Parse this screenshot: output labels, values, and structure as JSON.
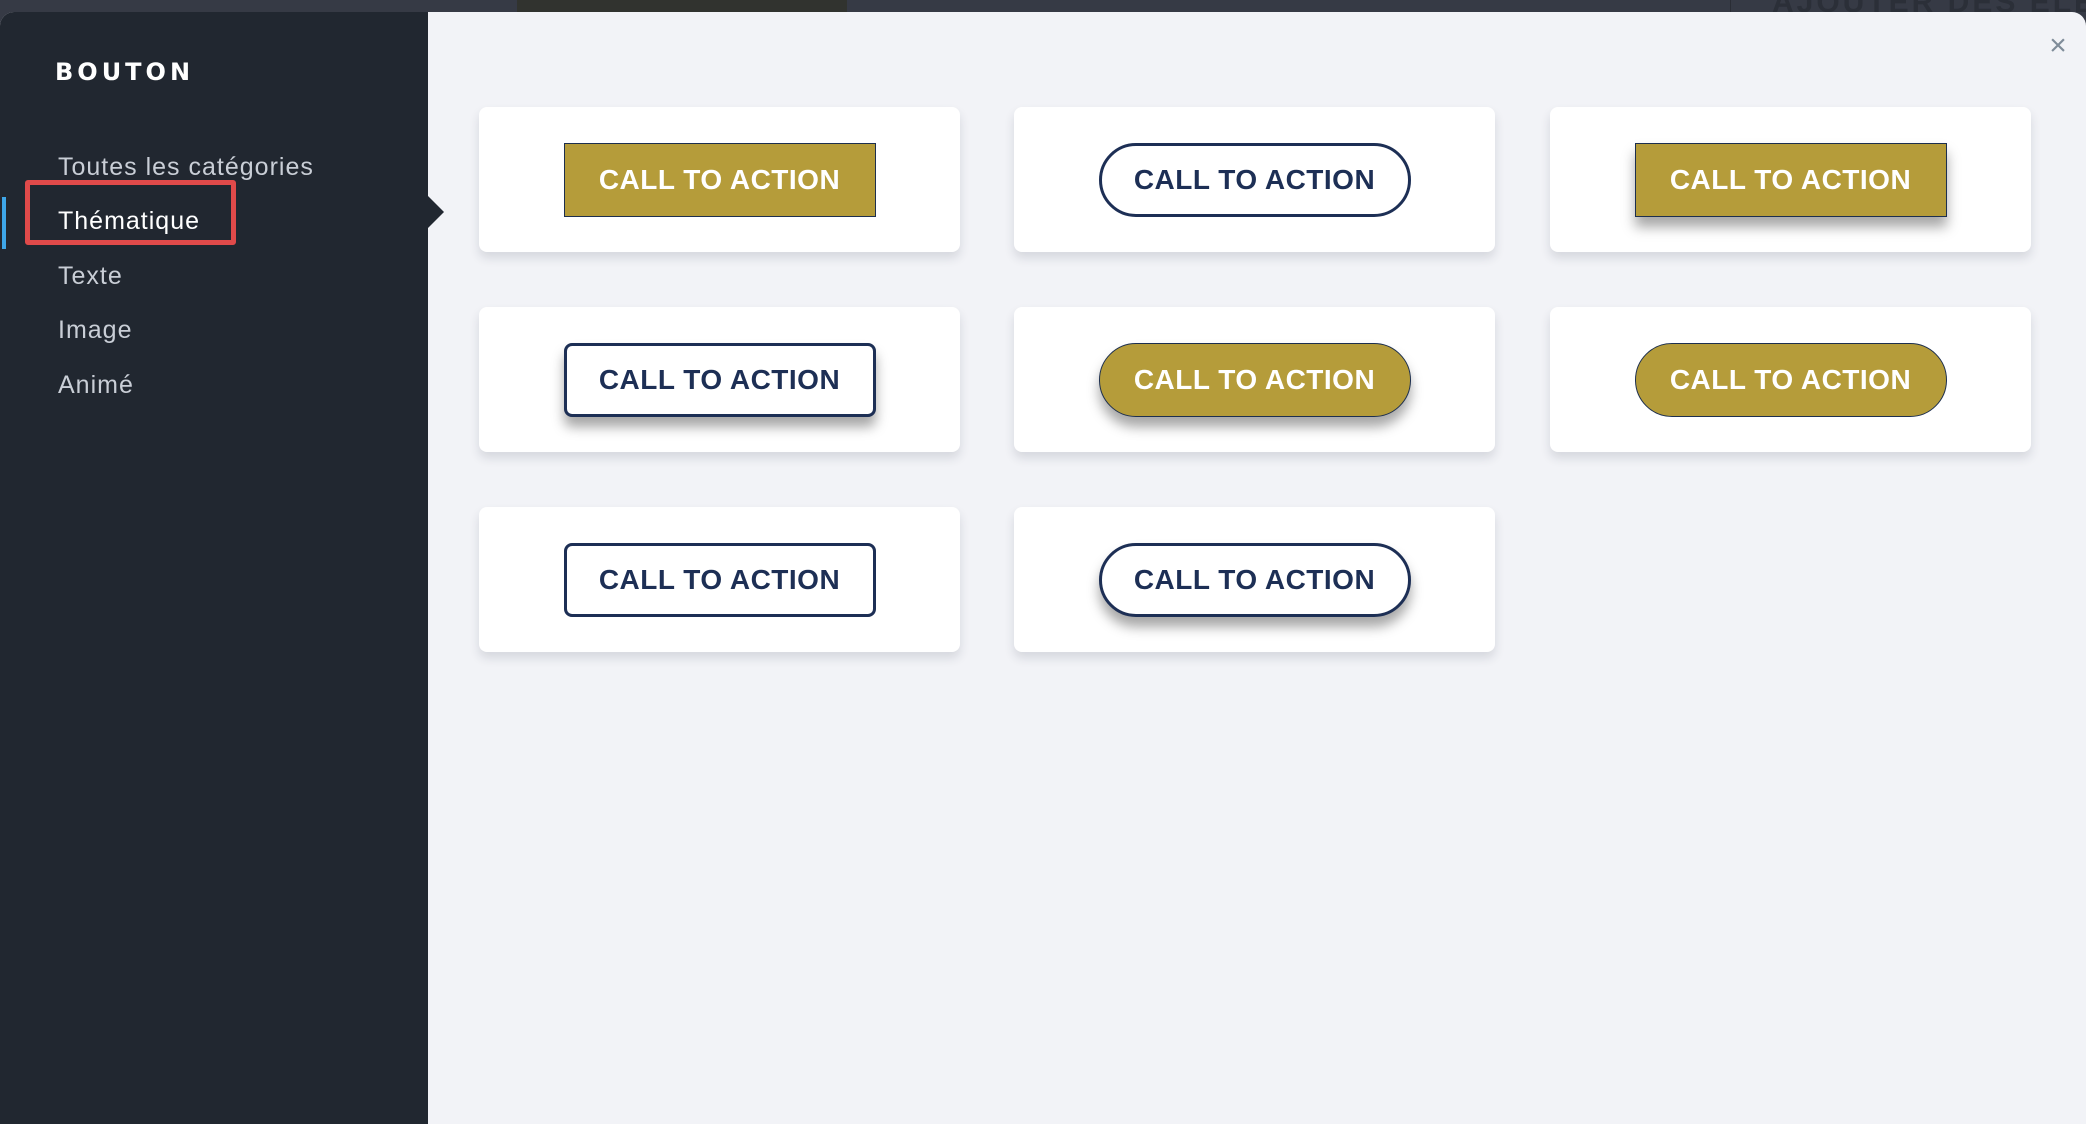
{
  "background": {
    "title_fragment": "AJOUTER DES ÉLÉMEN"
  },
  "sidebar": {
    "title": "BOUTON",
    "items": [
      {
        "label": "Toutes les catégories",
        "active": false
      },
      {
        "label": "Thématique",
        "active": true
      },
      {
        "label": "Texte",
        "active": false
      },
      {
        "label": "Image",
        "active": false
      },
      {
        "label": "Animé",
        "active": false
      }
    ],
    "active_color": "#3ea6e8",
    "highlight_color": "#e04a4a"
  },
  "close_icon": "×",
  "colors": {
    "gold": "#b59c3a",
    "navy": "#1d2f55",
    "sidebar_bg": "#212730",
    "content_bg": "#f2f3f7"
  },
  "buttons": [
    {
      "label": "CALL TO ACTION",
      "style": "gold square"
    },
    {
      "label": "CALL TO ACTION",
      "style": "outline pill"
    },
    {
      "label": "CALL TO ACTION",
      "style": "gold square shadow"
    },
    {
      "label": "CALL TO ACTION",
      "style": "outline rounded shadow"
    },
    {
      "label": "CALL TO ACTION",
      "style": "gold pill shadow"
    },
    {
      "label": "CALL TO ACTION",
      "style": "gold pill"
    },
    {
      "label": "CALL TO ACTION",
      "style": "outline rounded"
    },
    {
      "label": "CALL TO ACTION",
      "style": "outline pill shadow"
    }
  ]
}
